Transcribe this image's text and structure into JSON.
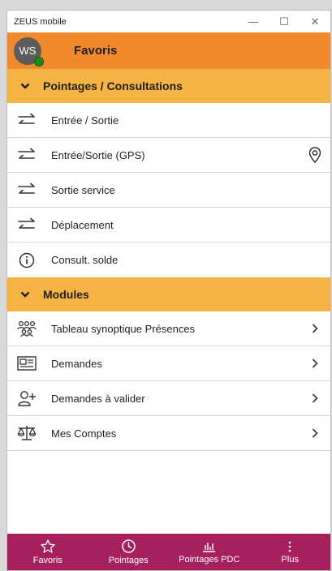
{
  "window": {
    "title": "ZEUS mobile",
    "controls": {
      "minimize": "—",
      "maximize": "☐",
      "close": "✕"
    }
  },
  "header": {
    "avatar_initials": "WS",
    "presence": "online",
    "title": "Favoris"
  },
  "sections": [
    {
      "title": "Pointages / Consultations",
      "items": [
        {
          "label": "Entrée / Sortie",
          "icon": "swap-arrows-icon"
        },
        {
          "label": "Entrée/Sortie (GPS)",
          "icon": "swap-arrows-icon",
          "trailing": "location-pin-icon"
        },
        {
          "label": "Sortie service",
          "icon": "swap-arrows-icon"
        },
        {
          "label": "Déplacement",
          "icon": "swap-arrows-icon"
        },
        {
          "label": "Consult. solde",
          "icon": "info-icon"
        }
      ]
    },
    {
      "title": "Modules",
      "items": [
        {
          "label": "Tableau synoptique Présences",
          "icon": "people-group-icon",
          "trailing": "chevron-right-icon"
        },
        {
          "label": "Demandes",
          "icon": "news-icon",
          "trailing": "chevron-right-icon"
        },
        {
          "label": "Demandes à valider",
          "icon": "add-person-icon",
          "trailing": "chevron-right-icon"
        },
        {
          "label": "Mes Comptes",
          "icon": "balance-scale-icon",
          "trailing": "chevron-right-icon"
        }
      ]
    }
  ],
  "bottom_nav": [
    {
      "label": "Favoris",
      "icon": "star-icon"
    },
    {
      "label": "Pointages",
      "icon": "clock-icon"
    },
    {
      "label": "Pointages PDC",
      "icon": "bar-chart-icon"
    },
    {
      "label": "Plus",
      "icon": "more-vertical-icon"
    }
  ],
  "colors": {
    "header": "#f1892d",
    "section": "#f4b343",
    "bottom_nav": "#a6205e",
    "presence": "#1f8a1f"
  }
}
